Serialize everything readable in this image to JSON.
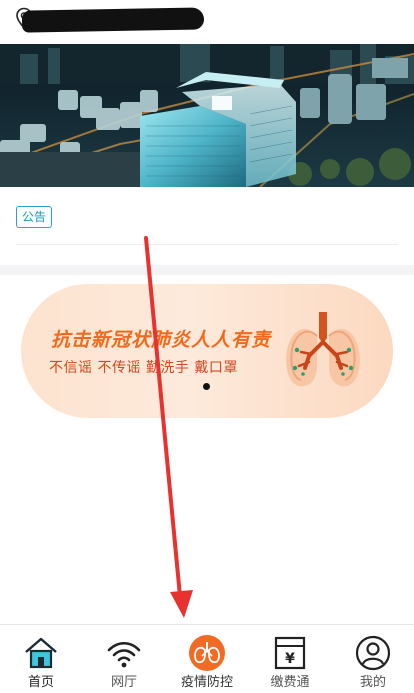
{
  "header": {
    "location_text": "",
    "location_icon": "location-pin-icon",
    "location_redacted": true
  },
  "banner": {
    "image": "city-aerial-night-buildings"
  },
  "notice": {
    "badge_label": "公告",
    "text": ""
  },
  "campaign": {
    "title": "抗击新冠状肺炎人人有责",
    "slogan": "不信谣 不传谣 勤洗手 戴口罩",
    "icon": "lungs-icon",
    "carousel_active_index": 0,
    "colors": {
      "title": "#f06a1d",
      "slogan": "#d4471f",
      "background": "#fde3cf"
    }
  },
  "annotation": {
    "type": "red-arrow",
    "color": "#e8322f"
  },
  "tabbar": {
    "active_index": 0,
    "items": [
      {
        "label": "首页",
        "icon": "home-icon"
      },
      {
        "label": "网厅",
        "icon": "wifi-icon"
      },
      {
        "label": "疫情防控",
        "icon": "lungs-icon"
      },
      {
        "label": "缴费通",
        "icon": "yen-bill-icon"
      },
      {
        "label": "我的",
        "icon": "user-icon"
      }
    ],
    "colors": {
      "accent": "#3ec6dc",
      "center_circle": "#f26b24"
    }
  }
}
